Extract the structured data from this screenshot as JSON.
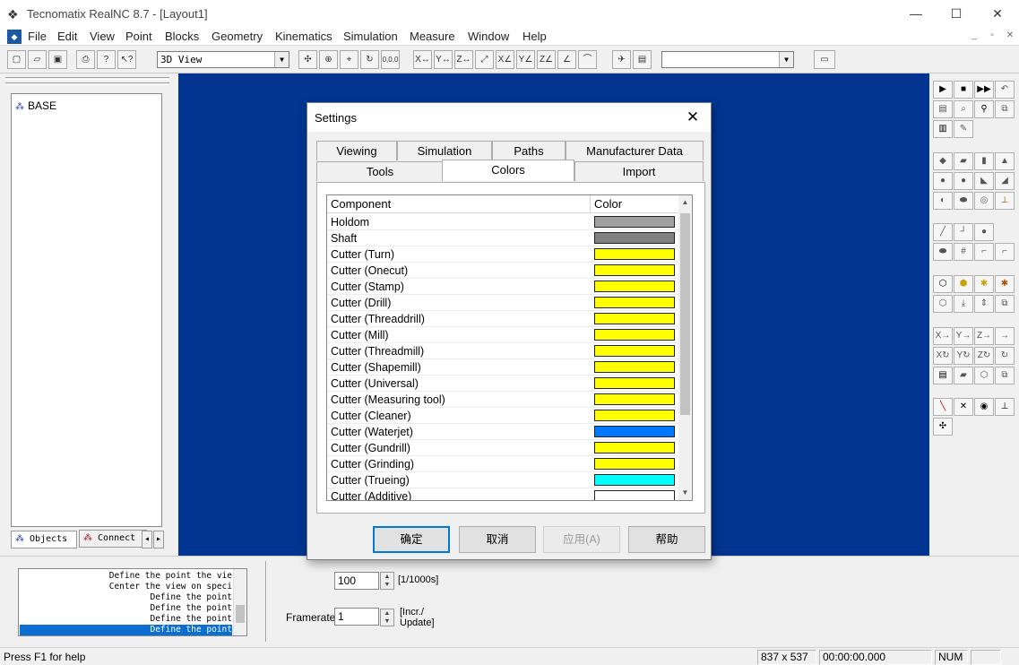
{
  "window": {
    "title": "Tecnomatix RealNC 8.7 - [Layout1]",
    "minimize": "—",
    "maximize": "☐",
    "close": "✕"
  },
  "menu": [
    "File",
    "Edit",
    "View",
    "Point",
    "Blocks",
    "Geometry",
    "Kinematics",
    "Simulation",
    "Measure",
    "Window",
    "Help"
  ],
  "toolbar": {
    "view_select": "3D View",
    "coord_button": "0,0,0",
    "right_select": ""
  },
  "tree": {
    "root": "BASE"
  },
  "left_tabs": {
    "objects": "Objects",
    "connect": "Connect"
  },
  "dialog": {
    "title": "Settings",
    "tabs_back": [
      "Viewing",
      "Simulation",
      "Paths",
      "Manufacturer Data"
    ],
    "tabs_front": [
      "Tools",
      "Colors",
      "Import"
    ],
    "active_tab": "Colors",
    "columns": {
      "component": "Component",
      "color": "Color"
    },
    "rows": [
      {
        "name": "Holdom",
        "color": "#a0a0a0"
      },
      {
        "name": "Shaft",
        "color": "#808080"
      },
      {
        "name": "Cutter (Turn)",
        "color": "#ffff00"
      },
      {
        "name": "Cutter (Onecut)",
        "color": "#ffff00"
      },
      {
        "name": "Cutter (Stamp)",
        "color": "#ffff00"
      },
      {
        "name": "Cutter (Drill)",
        "color": "#ffff00"
      },
      {
        "name": "Cutter (Threaddrill)",
        "color": "#ffff00"
      },
      {
        "name": "Cutter (Mill)",
        "color": "#ffff00"
      },
      {
        "name": "Cutter (Threadmill)",
        "color": "#ffff00"
      },
      {
        "name": "Cutter (Shapemill)",
        "color": "#ffff00"
      },
      {
        "name": "Cutter (Universal)",
        "color": "#ffff00"
      },
      {
        "name": "Cutter (Measuring tool)",
        "color": "#ffff00"
      },
      {
        "name": "Cutter (Cleaner)",
        "color": "#ffff00"
      },
      {
        "name": "Cutter (Waterjet)",
        "color": "#0078ff"
      },
      {
        "name": "Cutter (Gundrill)",
        "color": "#ffff00"
      },
      {
        "name": "Cutter (Grinding)",
        "color": "#ffff00"
      },
      {
        "name": "Cutter (Trueing)",
        "color": "#00ffff"
      },
      {
        "name": "Cutter (Additive)",
        "color": "#ffffff"
      }
    ],
    "buttons": {
      "ok": "确定",
      "cancel": "取消",
      "apply": "应用(A)",
      "help": "帮助"
    }
  },
  "log": {
    "lines": [
      "Define the point the vie",
      "Center the view on speci",
      "Define the point",
      "Define the point",
      "Define the point",
      "Define the point"
    ]
  },
  "sim": {
    "interval_value": "100",
    "interval_unit": "[1/1000s]",
    "framerate_label": "Framerate:",
    "framerate_value": "1",
    "framerate_unit1": "[Incr./",
    "framerate_unit2": "Update]"
  },
  "status": {
    "help": "Press F1 for help",
    "size": "837 x 537",
    "time": "00:00:00.000",
    "num": "NUM"
  },
  "colors": {
    "viewport": "#023592",
    "selection": "#0a6fd1"
  }
}
